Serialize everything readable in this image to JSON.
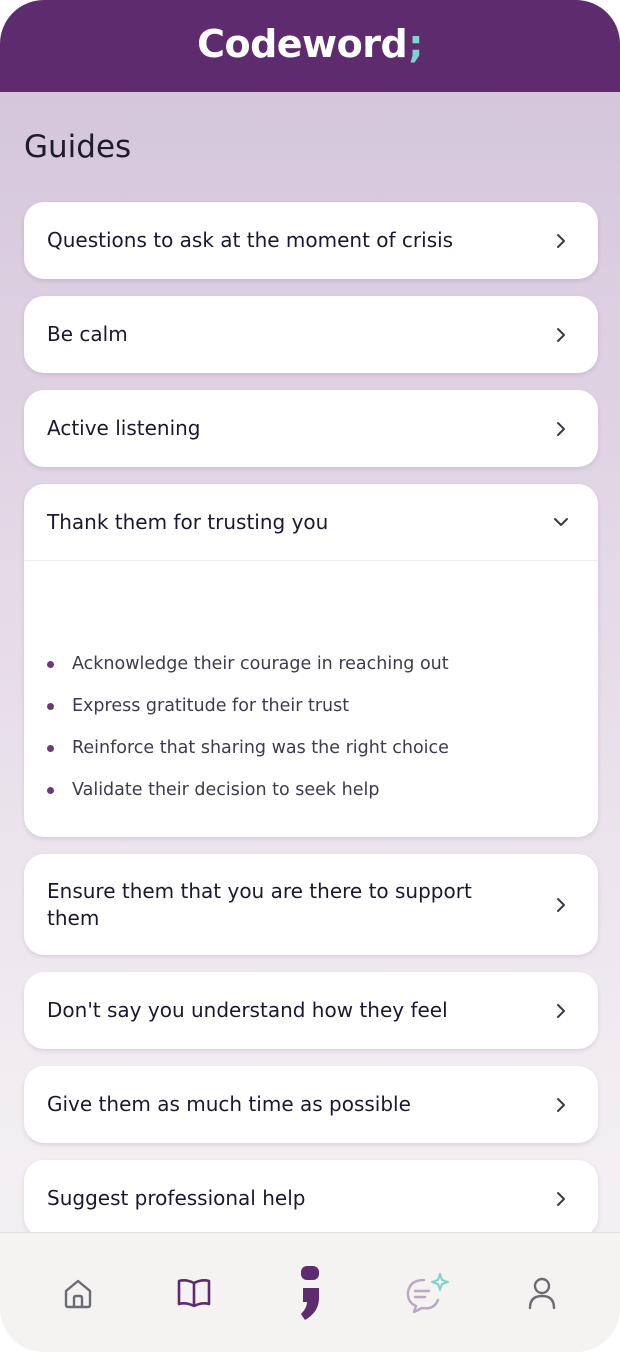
{
  "header": {
    "brand": "Codeword",
    "brand_mark": ";"
  },
  "page": {
    "title": "Guides"
  },
  "guides": [
    {
      "title": "Questions to ask at the moment of crisis",
      "expanded": false
    },
    {
      "title": "Be calm",
      "expanded": false
    },
    {
      "title": "Active listening",
      "expanded": false
    },
    {
      "title": "Thank them for trusting you",
      "expanded": true,
      "points": [
        "Acknowledge their courage in reaching out",
        "Express gratitude for their trust",
        "Reinforce that sharing was the right choice",
        "Validate their decision to seek help"
      ]
    },
    {
      "title": "Ensure them that you are there to support them",
      "expanded": false
    },
    {
      "title": "Don't say you understand how they feel",
      "expanded": false
    },
    {
      "title": "Give them as much time as possible",
      "expanded": false
    },
    {
      "title": "Suggest professional help",
      "expanded": false
    }
  ],
  "tabbar": {
    "items": [
      {
        "icon": "home-icon"
      },
      {
        "icon": "book-icon",
        "active": true
      },
      {
        "icon": "codeword-mark-icon"
      },
      {
        "icon": "ai-chat-icon"
      },
      {
        "icon": "profile-icon"
      }
    ]
  },
  "colors": {
    "brand": "#5e2b6f",
    "accent": "#7fd3c8",
    "bullet": "#6c3a7c"
  }
}
